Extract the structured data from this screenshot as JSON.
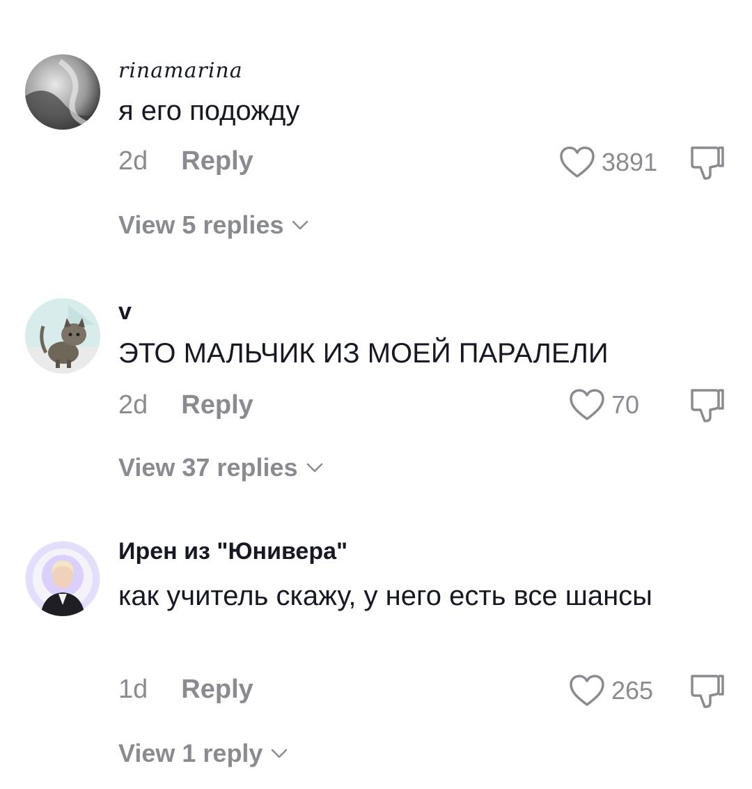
{
  "comments": [
    {
      "username": "rinamarina",
      "text": "я его подожду",
      "time": "2d",
      "reply_label": "Reply",
      "likes": "3891",
      "view_replies": "View 5 replies"
    },
    {
      "username": "v",
      "text": "ЭТО МАЛЬЧИК ИЗ МОЕЙ ПАРАЛЕЛИ",
      "time": "2d",
      "reply_label": "Reply",
      "likes": "70",
      "view_replies": "View 37 replies"
    },
    {
      "username": "Ирен из \"Юнивера\"",
      "text": "как учитель скажу, у него есть все шансы",
      "time": "1d",
      "reply_label": "Reply",
      "likes": "265",
      "view_replies": "View 1 reply"
    }
  ],
  "icons": {
    "like": "heart-outline-icon",
    "dislike": "thumbs-down-icon",
    "expand": "chevron-down-icon"
  },
  "colors": {
    "text": "#161823",
    "muted": "#8a8b91"
  }
}
